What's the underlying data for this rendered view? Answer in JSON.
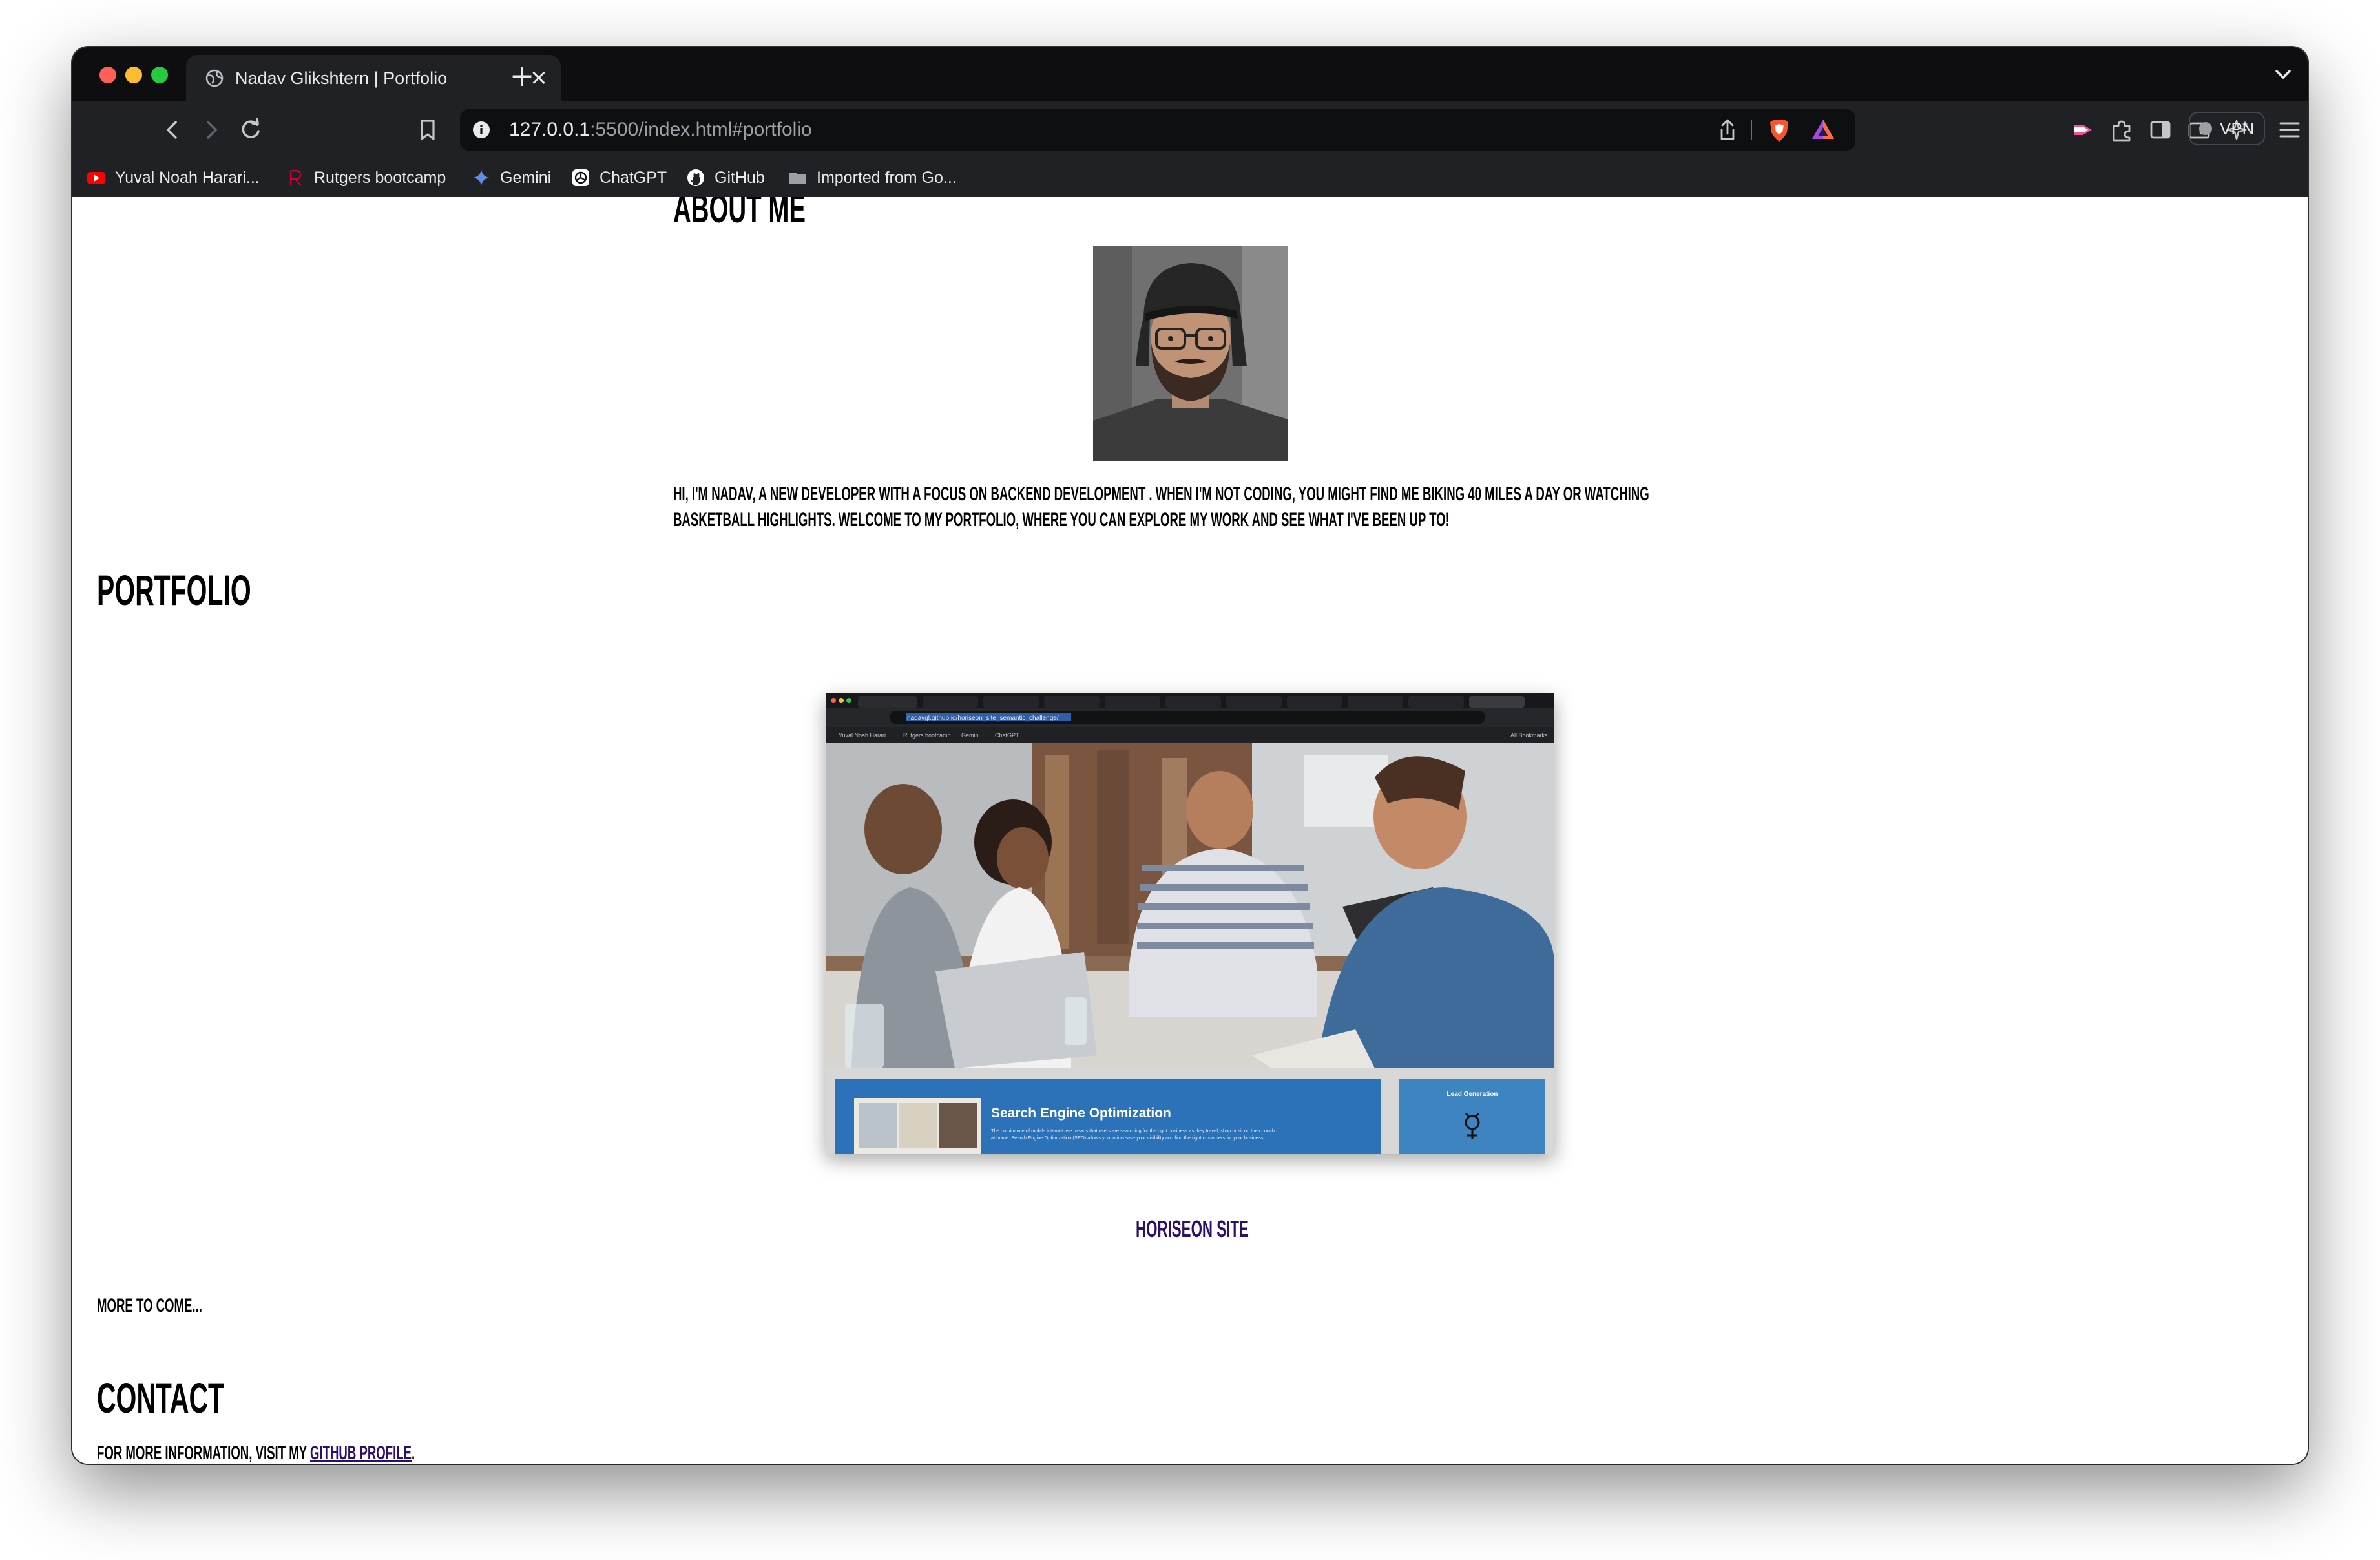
{
  "browser": {
    "tab_title": "Nadav Glikshtern | Portfolio",
    "url_host": "127.0.0.1",
    "url_path": ":5500/index.html#portfolio",
    "vpn_label": "VPN",
    "bookmarks": [
      {
        "label": "Yuval Noah Harari...",
        "icon": "youtube-icon"
      },
      {
        "label": "Rutgers bootcamp",
        "icon": "rutgers-icon"
      },
      {
        "label": "Gemini",
        "icon": "gemini-icon"
      },
      {
        "label": "ChatGPT",
        "icon": "chatgpt-icon"
      },
      {
        "label": "GitHub",
        "icon": "github-icon"
      },
      {
        "label": "Imported from Go...",
        "icon": "folder-icon"
      }
    ]
  },
  "page": {
    "about_title": "ABOUT ME",
    "bio_line_1": "HI, I'M NADAV, A NEW DEVELOPER WITH A FOCUS ON BACKEND DEVELOPMENT . WHEN I'M NOT CODING, YOU MIGHT FIND ME BIKING 40 MILES A DAY OR WATCHING",
    "bio_line_2": "BASKETBALL HIGHLIGHTS. WELCOME TO MY PORTFOLIO, WHERE YOU CAN EXPLORE MY WORK AND SEE WHAT I'VE BEEN UP TO!",
    "portfolio_title": "PORTFOLIO",
    "project_link": "HORISEON SITE",
    "more_text": "MORE TO COME...",
    "contact_title": "CONTACT",
    "contact_prefix": "FOR MORE INFORMATION, VISIT MY ",
    "contact_link": "GITHUB PROFILE",
    "contact_suffix": "."
  },
  "project_screenshot": {
    "url": "nadavgl.github.io/horiseon_site_semantic_challenge/",
    "bookmarks": [
      "Yuval Noah Harari...",
      "Rutgers bootcamp",
      "Gemini",
      "ChatGPT"
    ],
    "all_bookmarks": "All Bookmarks",
    "seo_title": "Search Engine Optimization",
    "seo_body_1": "The dominance of mobile internet use means that users are searching for the right business as they travel, shop or sit on their couch",
    "seo_body_2": "at home. Search Engine Optimization (SEO) allows you to increase your visibility and find the right customers for your business.",
    "lead_title": "Lead Generation"
  },
  "colors": {
    "link": "#2b0f70",
    "seo_blue": "#2b72b8",
    "lead_blue": "#3d84c0"
  }
}
